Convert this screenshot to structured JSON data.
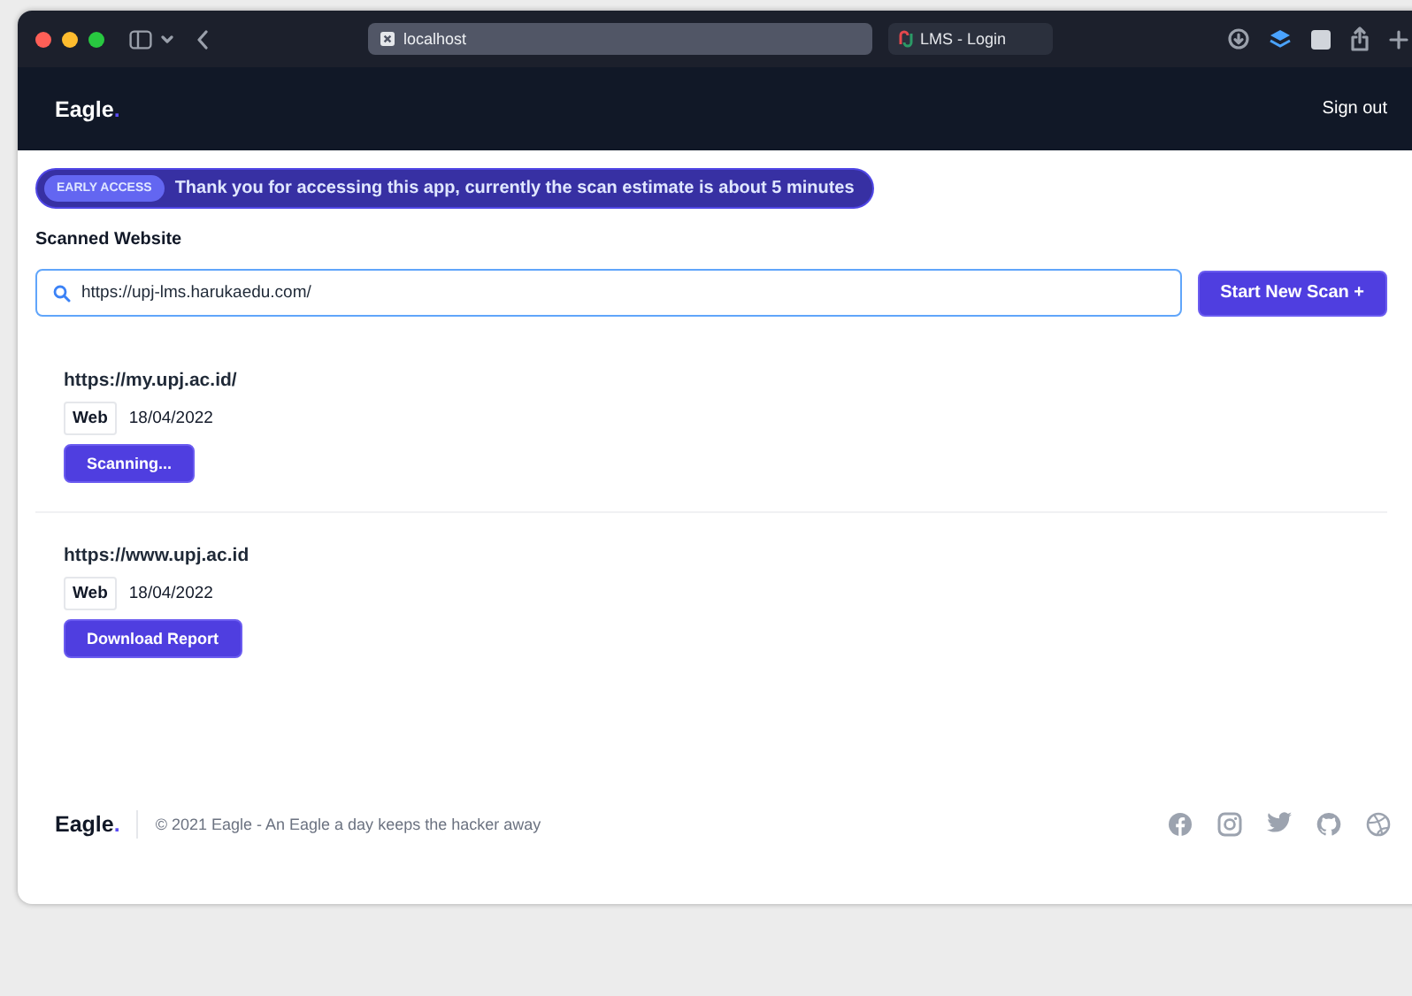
{
  "browser": {
    "address": "localhost",
    "tab_title": "LMS - Login"
  },
  "nav": {
    "logo": "Eagle",
    "logo_dot": ".",
    "action": "Sign out"
  },
  "banner": {
    "badge": "EARLY ACCESS",
    "message": "Thank you for accessing this app, currently the scan estimate is about 5 minutes"
  },
  "section_title": "Scanned Website",
  "search": {
    "value": "https://upj-lms.harukaedu.com/"
  },
  "start_button": "Start New Scan +",
  "scans": [
    {
      "url": "https://my.upj.ac.id/",
      "type": "Web",
      "date": "18/04/2022",
      "action": "Scanning..."
    },
    {
      "url": "https://www.upj.ac.id",
      "type": "Web",
      "date": "18/04/2022",
      "action": "Download Report"
    }
  ],
  "footer": {
    "logo": "Eagle",
    "logo_dot": ".",
    "copyright": "© 2021 Eagle - An Eagle a day keeps the hacker away"
  }
}
